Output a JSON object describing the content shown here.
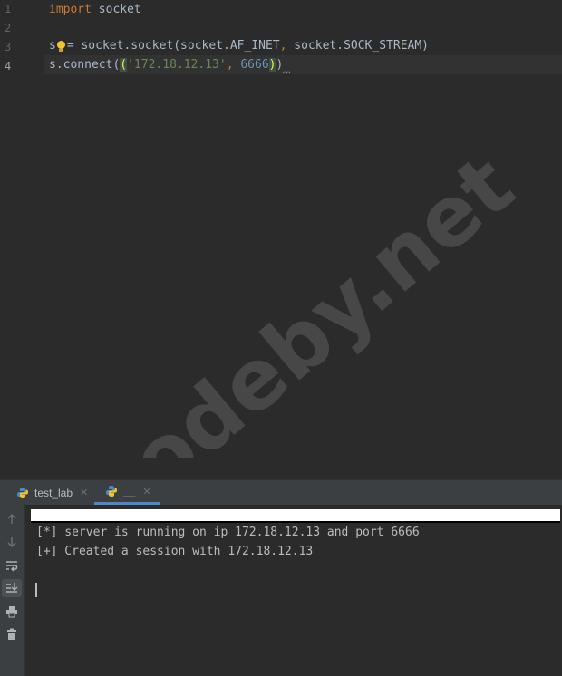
{
  "editor": {
    "line_numbers": [
      "1",
      "2",
      "3",
      "4"
    ],
    "line1": {
      "keyword": "import",
      "module": " socket"
    },
    "line3": {
      "var": "s",
      "eq": "= ",
      "call": "socket.socket(socket.AF_INET",
      "comma": ",",
      "rest": " socket.SOCK_STREAM)"
    },
    "line4": {
      "prefix": "s.connect(",
      "open_paren": "(",
      "ip": "'172.18.12.13'",
      "comma": ",",
      "port": " 6666",
      "close_paren": ")",
      "tail": ")"
    }
  },
  "watermark": "codeby.net",
  "run_panel": {
    "tabs": [
      {
        "label": "test_lab",
        "close": "✕"
      },
      {
        "label": "__",
        "close": "✕"
      }
    ],
    "console_lines": [
      "[*] server is running on ip 172.18.12.13 and port 6666",
      "[+] Created a session with 172.18.12.13"
    ],
    "toolbar_icons": [
      "arrow-up-icon",
      "arrow-down-icon",
      "soft-wrap-icon",
      "scroll-to-end-icon",
      "print-icon",
      "trash-icon"
    ]
  },
  "colors": {
    "background": "#2b2b2b",
    "keyword": "#cc7832",
    "string": "#6a8759",
    "number": "#6897bb",
    "text": "#a9b7c6",
    "accent": "#4a88c7"
  }
}
